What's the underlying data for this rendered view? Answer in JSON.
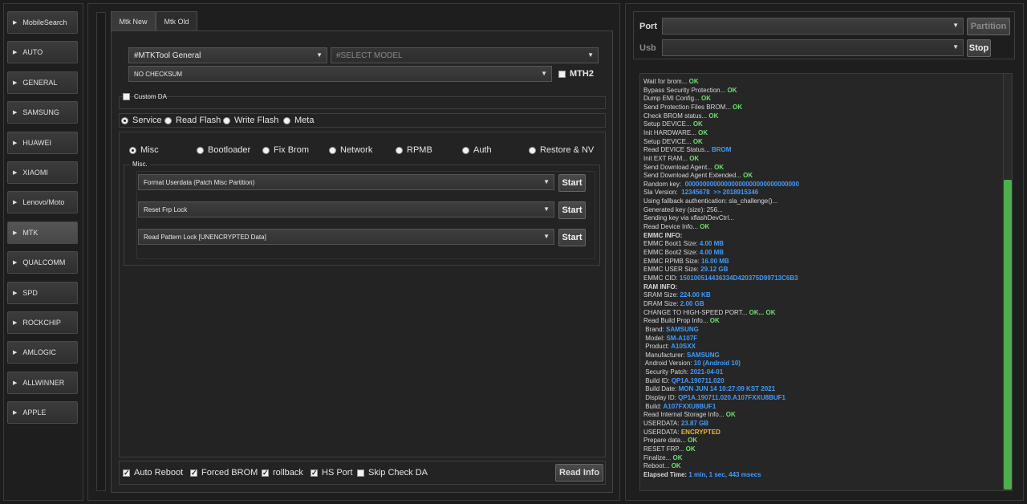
{
  "sidebar": {
    "items": [
      {
        "label": "MobileSearch"
      },
      {
        "label": "AUTO"
      },
      {
        "label": "GENERAL"
      },
      {
        "label": "SAMSUNG"
      },
      {
        "label": "HUAWEI"
      },
      {
        "label": "XIAOMI"
      },
      {
        "label": "Lenovo/Moto"
      },
      {
        "label": "MTK",
        "active": true
      },
      {
        "label": "QUALCOMM"
      },
      {
        "label": "SPD"
      },
      {
        "label": "ROCKCHIP"
      },
      {
        "label": "AMLOGIC"
      },
      {
        "label": "ALLWINNER"
      },
      {
        "label": "APPLE"
      }
    ]
  },
  "tabs": {
    "mtk_new": "Mtk New",
    "mtk_old": "Mtk Old"
  },
  "device": {
    "tool": "#MTKTool General",
    "model_placeholder": "#SELECT MODEL",
    "checksum": "NO CHECKSUM",
    "mth2": "MTH2",
    "custom_da": "Custom DA"
  },
  "modes": {
    "service": "Service",
    "read_flash": "Read Flash",
    "write_flash": "Write Flash",
    "meta": "Meta"
  },
  "subtabs": {
    "misc": "Misc",
    "bootloader": "Bootloader",
    "fix_brom": "Fix Brom",
    "network": "Network",
    "rpmb": "RPMB",
    "auth": "Auth",
    "restore_nv": "Restore & NV"
  },
  "misc_group": {
    "title": "Misc.",
    "ops": [
      {
        "label": "Format Userdata (Patch Misc Partition)",
        "button": "Start"
      },
      {
        "label": "Reset Frp Lock",
        "button": "Start"
      },
      {
        "label": "Read Pattern Lock [UNENCRYPTED Data]",
        "button": "Start"
      }
    ]
  },
  "options": {
    "auto_reboot": "Auto Reboot",
    "forced_brom": "Forced BROM",
    "rollback": "rollback",
    "hs_port": "HS Port",
    "skip_check_da": "Skip Check DA",
    "read_info": "Read Info"
  },
  "connection": {
    "port_label": "Port",
    "usb_label": "Usb",
    "partition": "Partition",
    "stop": "Stop",
    "port_value": "",
    "usb_value": ""
  },
  "colors": {
    "ok": "#6fe06f",
    "value": "#3f9cff",
    "warning": "#f0b830",
    "scroll_thumb": "#4cae4c"
  },
  "log": [
    {
      "t": "Wait for brom... ",
      "v": "OK",
      "c": "ok"
    },
    {
      "t": "Bypass Security Protection... ",
      "v": "OK",
      "c": "ok"
    },
    {
      "t": "Dump EMI Config... ",
      "v": "OK",
      "c": "ok"
    },
    {
      "t": "Send Protection Files BROM... ",
      "v": "OK",
      "c": "ok"
    },
    {
      "t": "Check BROM status... ",
      "v": "OK",
      "c": "ok"
    },
    {
      "t": "Setup DEVICE... ",
      "v": "OK",
      "c": "ok"
    },
    {
      "t": "Init HARDWARE... ",
      "v": "OK",
      "c": "ok"
    },
    {
      "t": "Setup DEVICE... ",
      "v": "OK",
      "c": "ok"
    },
    {
      "t": "Read DEVICE Status... ",
      "v": "BROM",
      "c": "val"
    },
    {
      "t": "Init EXT RAM... ",
      "v": "OK",
      "c": "ok"
    },
    {
      "t": "Send Download Agent... ",
      "v": "OK",
      "c": "ok"
    },
    {
      "t": "Send Download Agent Extended... ",
      "v": "OK",
      "c": "ok"
    },
    {
      "t": "Random key:  ",
      "v": "00000000000000000000000000000000",
      "c": "val"
    },
    {
      "t": "Sla Version:  ",
      "v": "12345678  >> 2018915346",
      "c": "val"
    },
    {
      "t": "Using fallback authentication: sla_challenge()...",
      "v": "",
      "c": ""
    },
    {
      "t": "Generated key (size): 256...",
      "v": "",
      "c": ""
    },
    {
      "t": "Sending key via xflashDevCtrl...",
      "v": "",
      "c": ""
    },
    {
      "t": "Read Device Info... ",
      "v": "OK",
      "c": "ok"
    },
    {
      "t": "EMMC INFO:",
      "v": "",
      "c": "",
      "b": true
    },
    {
      "t": "EMMC Boot1 Size: ",
      "v": "4.00 MB",
      "c": "val"
    },
    {
      "t": "EMMC Boot2 Size: ",
      "v": "4.00 MB",
      "c": "val"
    },
    {
      "t": "EMMC RPMB Size: ",
      "v": "16.00 MB",
      "c": "val"
    },
    {
      "t": "EMMC USER Size: ",
      "v": "29.12 GB",
      "c": "val"
    },
    {
      "t": "EMMC CID: ",
      "v": "150100514436334D420375D99713C6B3",
      "c": "val"
    },
    {
      "t": "RAM INFO:",
      "v": "",
      "c": "",
      "b": true
    },
    {
      "t": "SRAM Size: ",
      "v": "224.00 KB",
      "c": "val"
    },
    {
      "t": "DRAM Size: ",
      "v": "2.00 GB",
      "c": "val"
    },
    {
      "t": "CHANGE TO HIGH-SPEED PORT... ",
      "v": "OK... OK",
      "c": "ok"
    },
    {
      "t": "Read Build Prop Info... ",
      "v": "OK",
      "c": "ok"
    },
    {
      "t": " Brand: ",
      "v": "SAMSUNG",
      "c": "val"
    },
    {
      "t": " Model: ",
      "v": "SM-A107F",
      "c": "val"
    },
    {
      "t": " Product: ",
      "v": "A10SXX",
      "c": "val"
    },
    {
      "t": " Manufacturer: ",
      "v": "SAMSUNG",
      "c": "val"
    },
    {
      "t": " Android Version: ",
      "v": "10 (Android 10)",
      "c": "val"
    },
    {
      "t": " Security Patch: ",
      "v": "2021-04-01",
      "c": "val"
    },
    {
      "t": " Build ID: ",
      "v": "QP1A.190711.020",
      "c": "val"
    },
    {
      "t": " Build Date: ",
      "v": "MON JUN 14 10:27:09 KST 2021",
      "c": "val"
    },
    {
      "t": " Display ID: ",
      "v": "QP1A.190711.020.A107FXXU8BUF1",
      "c": "val"
    },
    {
      "t": " Build: ",
      "v": "A107FXXU8BUF1",
      "c": "val"
    },
    {
      "t": "Read Internal Storage Info... ",
      "v": "OK",
      "c": "ok"
    },
    {
      "t": "USERDATA: ",
      "v": "23.87 GB",
      "c": "val"
    },
    {
      "t": "USERDATA: ",
      "v": "ENCRYPTED",
      "c": "warn"
    },
    {
      "t": "Prepare data... ",
      "v": "OK",
      "c": "ok"
    },
    {
      "t": "RESET FRP... ",
      "v": "OK",
      "c": "ok"
    },
    {
      "t": "Finalize... ",
      "v": "OK",
      "c": "ok"
    },
    {
      "t": "Reboot... ",
      "v": "OK",
      "c": "ok"
    },
    {
      "t": "Elapsed Time: ",
      "v": "1 min, 1 sec, 443 msecs",
      "c": "val",
      "b": true
    }
  ]
}
